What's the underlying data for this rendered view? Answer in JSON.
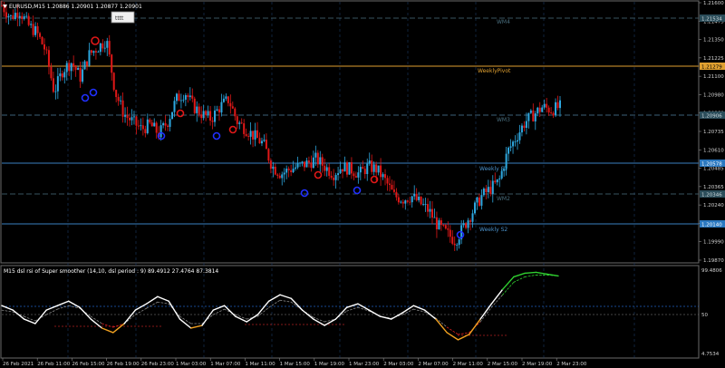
{
  "window": {
    "title": "EURUSD,M15 1.20886 1.20901 1.20877 1.20901",
    "tag_button_label": "tttt"
  },
  "price_panel": {
    "axis_ticks": [
      "1.21600",
      "1.21475",
      "1.21350",
      "1.21225",
      "1.21100",
      "1.20980",
      "1.20860",
      "1.20735",
      "1.20610",
      "1.20485",
      "1.20365",
      "1.20240",
      "1.20115",
      "1.19990",
      "1.19870"
    ],
    "current_price": "1.20901",
    "levels": [
      {
        "name": "WM4",
        "label": "WM4",
        "price_label": "1.21534",
        "color": "#4a6f7f",
        "style": "dash"
      },
      {
        "name": "weekly-pivot",
        "label": "WeeklyPivot",
        "price_label": "1.21279",
        "color": "#e0a030",
        "style": "solid"
      },
      {
        "name": "wm3",
        "label": "WM3",
        "price_label": "1.20906",
        "color": "#5080a0",
        "style": "dash"
      },
      {
        "name": "weekly-s1",
        "label": "Weekly S1",
        "price_label": "1.20578",
        "color": "#3a80c0",
        "style": "solid"
      },
      {
        "name": "wm2",
        "label": "WM2",
        "price_label": "1.20346",
        "color": "#4a6f7f",
        "style": "dash"
      },
      {
        "name": "weekly-s2",
        "label": "Weekly S2",
        "price_label": "1.20140",
        "color": "#3a80c0",
        "style": "solid"
      }
    ]
  },
  "indicator_panel": {
    "title": "M15 dsl rsi of Super smoother (14,10, dsl period : 9) 89.4912 27.4764 87.3814",
    "axis_ticks": [
      "99.4806",
      "50",
      "4.7534"
    ]
  },
  "time_axis": [
    "26 Feb 2021",
    "26 Feb 11:00",
    "26 Feb 15:00",
    "26 Feb 19:00",
    "26 Feb 23:00",
    "1 Mar 03:00",
    "1 Mar 07:00",
    "1 Mar 11:00",
    "1 Mar 15:00",
    "1 Mar 19:00",
    "1 Mar 23:00",
    "2 Mar 03:00",
    "2 Mar 07:00",
    "2 Mar 11:00",
    "2 Mar 15:00",
    "2 Mar 19:00",
    "2 Mar 23:00"
  ],
  "colors": {
    "background": "#000000",
    "bull": "#2ea8e0",
    "bear": "#e01818",
    "rsi_neutral": "#ffffff",
    "rsi_low": "#f0a020",
    "rsi_high": "#30d030",
    "arrow_blue": "#2030ff",
    "arrow_red": "#e01818"
  },
  "chart_data": [
    {
      "type": "candlestick",
      "title": "EURUSD,M15",
      "price_range": [
        1.1987,
        1.216
      ],
      "x": [
        "26 Feb 2021",
        "26 Feb 11:00",
        "26 Feb 15:00",
        "26 Feb 19:00",
        "26 Feb 23:00",
        "1 Mar 03:00",
        "1 Mar 07:00",
        "1 Mar 11:00",
        "1 Mar 15:00",
        "1 Mar 19:00",
        "1 Mar 23:00",
        "2 Mar 03:00",
        "2 Mar 07:00",
        "2 Mar 11:00",
        "2 Mar 15:00",
        "2 Mar 19:00",
        "2 Mar 23:00"
      ],
      "close_path": [
        [
          0,
          1.2158
        ],
        [
          1,
          1.215
        ],
        [
          2,
          1.2155
        ],
        [
          3,
          1.2145
        ],
        [
          4,
          1.214
        ],
        [
          5,
          1.2128
        ],
        [
          6,
          1.21
        ],
        [
          7,
          1.2115
        ],
        [
          8,
          1.212
        ],
        [
          9,
          1.211
        ],
        [
          10,
          1.2125
        ],
        [
          11,
          1.213
        ],
        [
          12,
          1.2135
        ],
        [
          13,
          1.21
        ],
        [
          14,
          1.2085
        ],
        [
          15,
          1.208
        ],
        [
          16,
          1.2075
        ],
        [
          17,
          1.2078
        ],
        [
          18,
          1.2072
        ],
        [
          19,
          1.208
        ],
        [
          20,
          1.2095
        ],
        [
          21,
          1.21
        ],
        [
          22,
          1.209
        ],
        [
          23,
          1.2085
        ],
        [
          24,
          1.2082
        ],
        [
          25,
          1.209
        ],
        [
          26,
          1.2095
        ],
        [
          27,
          1.208
        ],
        [
          28,
          1.2075
        ],
        [
          29,
          1.207
        ],
        [
          30,
          1.2065
        ],
        [
          31,
          1.205
        ],
        [
          32,
          1.2045
        ],
        [
          33,
          1.2048
        ],
        [
          34,
          1.205
        ],
        [
          35,
          1.2052
        ],
        [
          36,
          1.2055
        ],
        [
          37,
          1.205
        ],
        [
          38,
          1.2045
        ],
        [
          39,
          1.205
        ],
        [
          40,
          1.2048
        ],
        [
          41,
          1.2045
        ],
        [
          42,
          1.205
        ],
        [
          43,
          1.2048
        ],
        [
          44,
          1.204
        ],
        [
          45,
          1.203
        ],
        [
          46,
          1.2028
        ],
        [
          47,
          1.203
        ],
        [
          48,
          1.2025
        ],
        [
          49,
          1.202
        ],
        [
          50,
          1.201
        ],
        [
          51,
          1.2005
        ],
        [
          52,
          1.2
        ],
        [
          53,
          1.201
        ],
        [
          54,
          1.202
        ],
        [
          55,
          1.203
        ],
        [
          56,
          1.2035
        ],
        [
          57,
          1.204
        ],
        [
          58,
          1.206
        ],
        [
          59,
          1.207
        ],
        [
          60,
          1.208
        ],
        [
          61,
          1.2085
        ],
        [
          62,
          1.209
        ],
        [
          63,
          1.2088
        ],
        [
          64,
          1.209
        ]
      ]
    },
    {
      "type": "line",
      "title": "M15 dsl rsi of Super smoother (14,10, dsl period : 9)",
      "ylim": [
        4.7534,
        99.4806
      ],
      "series": [
        {
          "name": "dsl rsi",
          "values": [
            60,
            55,
            45,
            40,
            55,
            60,
            65,
            58,
            45,
            35,
            30,
            40,
            55,
            62,
            70,
            65,
            45,
            35,
            38,
            55,
            60,
            48,
            42,
            50,
            65,
            72,
            68,
            55,
            45,
            38,
            45,
            58,
            62,
            55,
            48,
            45,
            52,
            60,
            55,
            45,
            30,
            22,
            28,
            45,
            62,
            78,
            92,
            96,
            97,
            95,
            93
          ]
        },
        {
          "name": "signal",
          "values": [
            55,
            53,
            48,
            43,
            50,
            56,
            60,
            57,
            48,
            40,
            36,
            40,
            50,
            57,
            64,
            62,
            48,
            40,
            40,
            50,
            56,
            50,
            45,
            48,
            58,
            66,
            64,
            55,
            47,
            42,
            45,
            54,
            58,
            54,
            48,
            46,
            50,
            56,
            53,
            46,
            36,
            28,
            30,
            42,
            58,
            72,
            86,
            92,
            94,
            94,
            93
          ]
        }
      ]
    }
  ]
}
